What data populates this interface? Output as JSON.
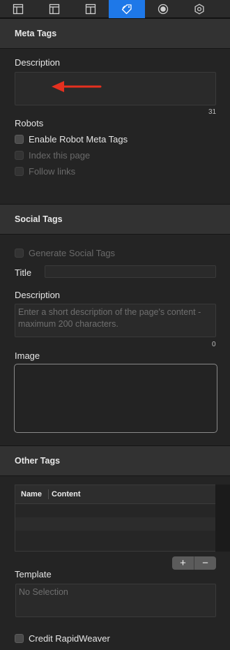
{
  "toolbar": {
    "tabs": [
      {
        "icon": "layout-icon",
        "active": false
      },
      {
        "icon": "layout-icon",
        "active": false
      },
      {
        "icon": "layout-icon",
        "active": false
      },
      {
        "icon": "tags-icon",
        "active": true
      },
      {
        "icon": "badge-icon",
        "active": false
      },
      {
        "icon": "gear-icon",
        "active": false
      }
    ],
    "accent": "#1e78e8"
  },
  "meta_tags": {
    "header": "Meta Tags",
    "description_label": "Description",
    "description_value": "",
    "description_count": "31",
    "robots_label": "Robots",
    "enable_robot_label": "Enable Robot Meta Tags",
    "index_page_label": "Index this page",
    "follow_links_label": "Follow links"
  },
  "social_tags": {
    "header": "Social Tags",
    "generate_label": "Generate Social Tags",
    "title_label": "Title",
    "description_label": "Description",
    "description_placeholder": "Enter a short description of the page's content - maximum 200 characters.",
    "description_count": "0",
    "image_label": "Image"
  },
  "other_tags": {
    "header": "Other Tags",
    "columns": [
      "Name",
      "Content"
    ],
    "add_label": "+",
    "remove_label": "−",
    "template_label": "Template",
    "template_placeholder": "No Selection",
    "credit_label": "Credit RapidWeaver"
  },
  "annotation_arrow_color": "#e5301f"
}
